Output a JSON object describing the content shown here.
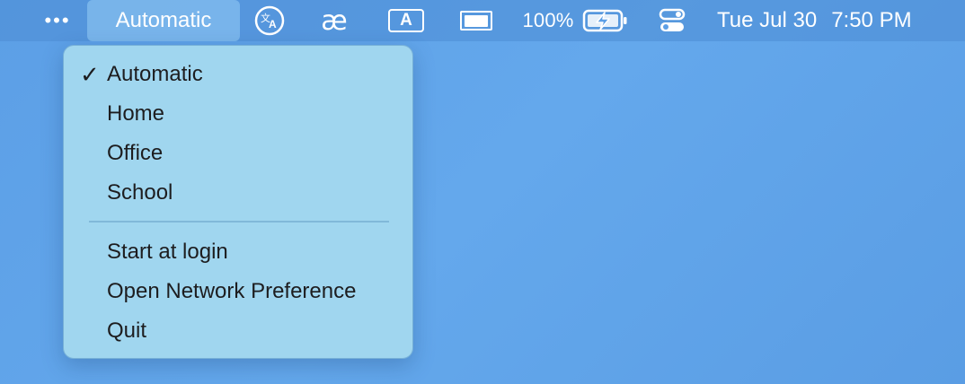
{
  "menubar": {
    "more_glyph": "•••",
    "network_location": "Automatic",
    "ae_glyph": "æ",
    "input_glyph": "A",
    "battery_percent": "100%",
    "date": "Tue Jul 30",
    "time": "7:50 PM",
    "icons": [
      "more-icon",
      "translate-icon",
      "ae-ligature-icon",
      "input-source-icon",
      "display-icon",
      "battery-charging-icon",
      "control-center-icon"
    ]
  },
  "dropdown": {
    "locations": [
      {
        "label": "Automatic",
        "checked": true
      },
      {
        "label": "Home",
        "checked": false
      },
      {
        "label": "Office",
        "checked": false
      },
      {
        "label": "School",
        "checked": false
      }
    ],
    "check_glyph": "✓",
    "actions": [
      {
        "label": "Start at login"
      },
      {
        "label": "Open Network Preference"
      },
      {
        "label": "Quit"
      }
    ]
  }
}
